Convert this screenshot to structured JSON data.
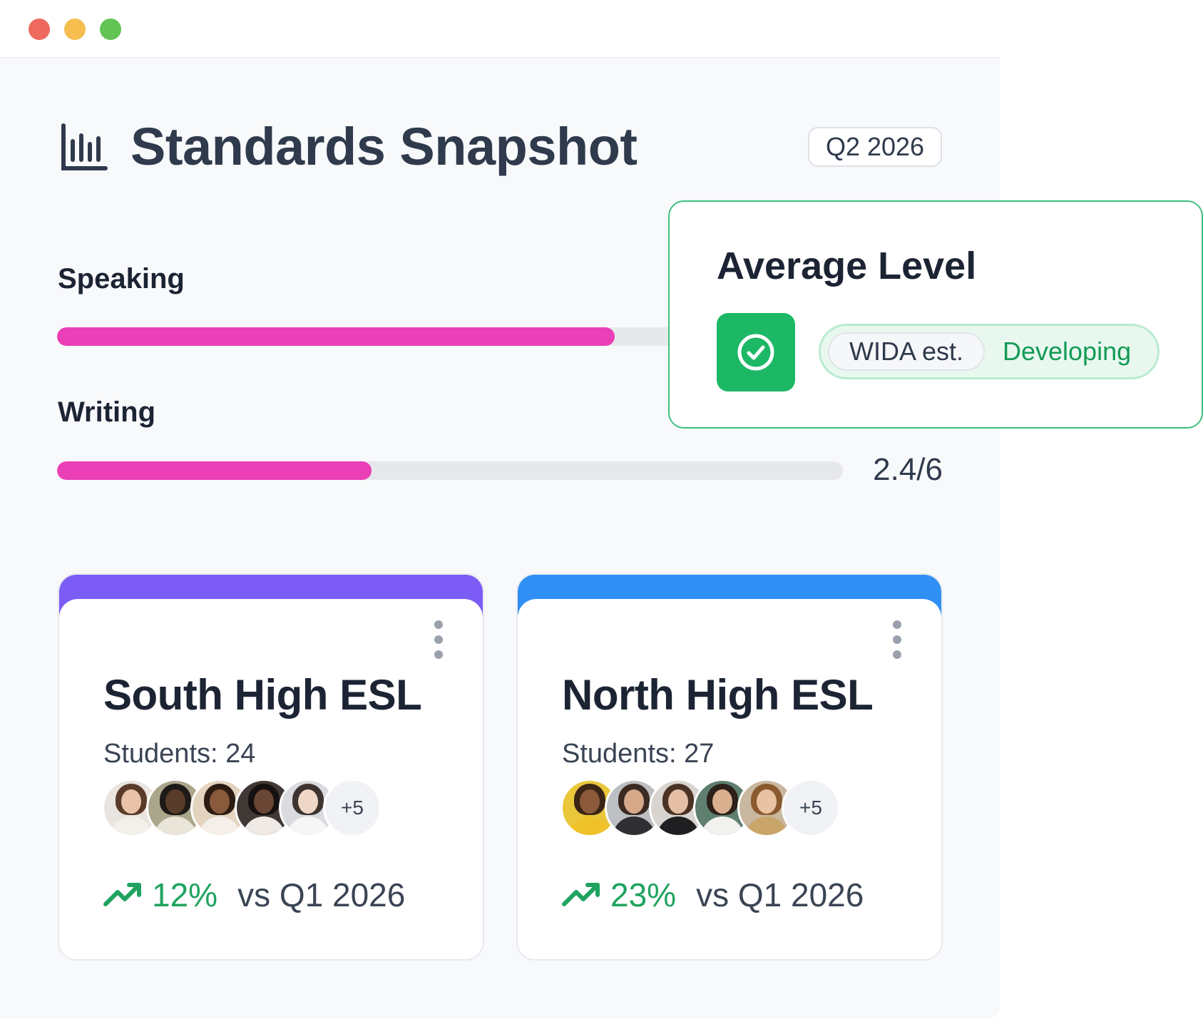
{
  "header": {
    "title": "Standards Snapshot",
    "period": "Q2 2026",
    "icon": "bar-chart-icon"
  },
  "metrics": [
    {
      "label": "Speaking",
      "progress": 0.71,
      "score": "",
      "color": "#ea3fb6"
    },
    {
      "label": "Writing",
      "progress": 0.4,
      "score": "2.4/6",
      "color": "#ea3fb6"
    }
  ],
  "average_level": {
    "title": "Average Level",
    "scale": "WIDA est.",
    "value": "Developing",
    "icon": "check-circle-icon",
    "accent": "#1db866"
  },
  "groups": [
    {
      "name": "South High ESL",
      "students": "Students: 24",
      "more": "+5",
      "change": "12%",
      "compare": "vs Q1 2026",
      "accent": "#7b5cf5"
    },
    {
      "name": "North High ESL",
      "students": "Students: 27",
      "more": "+5",
      "change": "23%",
      "compare": "vs Q1 2026",
      "accent": "#2f8ff5"
    }
  ]
}
